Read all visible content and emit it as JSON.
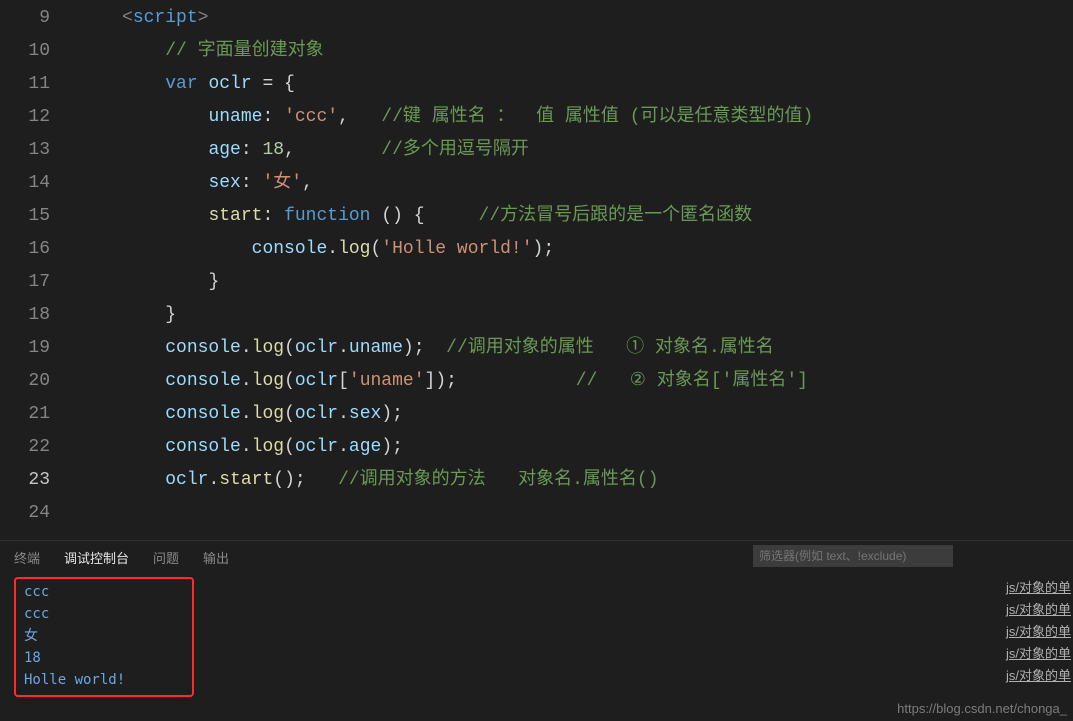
{
  "editor": {
    "lines": [
      {
        "num": 9,
        "segs": [
          " ",
          "<",
          "script",
          ">"
        ],
        "cls": [
          "sp",
          "tok-tag",
          "tok-tagname",
          "tok-tag"
        ]
      },
      {
        "num": 10,
        "segs": [
          "     ",
          "// 字面量创建对象"
        ],
        "cls": [
          "sp",
          "tok-comment"
        ]
      },
      {
        "num": 11,
        "segs": [
          "     ",
          "var ",
          "oclr",
          " = {"
        ],
        "cls": [
          "sp",
          "tok-keyword",
          "tok-var",
          "tok-punc"
        ]
      },
      {
        "num": 12,
        "segs": [
          "         ",
          "uname",
          ": ",
          "'ccc'",
          ",   ",
          "//键 属性名 ：  值 属性值 (可以是任意类型的值)"
        ],
        "cls": [
          "sp",
          "tok-prop",
          "tok-punc",
          "tok-string",
          "tok-punc",
          "tok-comment"
        ]
      },
      {
        "num": 13,
        "segs": [
          "         ",
          "age",
          ": ",
          "18",
          ",        ",
          "//多个用逗号隔开"
        ],
        "cls": [
          "sp",
          "tok-prop",
          "tok-punc",
          "tok-num",
          "tok-punc",
          "tok-comment"
        ]
      },
      {
        "num": 14,
        "segs": [
          "         ",
          "sex",
          ": ",
          "'女'",
          ","
        ],
        "cls": [
          "sp",
          "tok-prop",
          "tok-punc",
          "tok-string",
          "tok-punc"
        ]
      },
      {
        "num": 15,
        "segs": [
          "         ",
          "start",
          ": ",
          "function",
          " () {     ",
          "//方法冒号后跟的是一个匿名函数"
        ],
        "cls": [
          "sp",
          "tok-func",
          "tok-punc",
          "tok-keyword",
          "tok-punc",
          "tok-comment"
        ]
      },
      {
        "num": 16,
        "segs": [
          "             ",
          "console",
          ".",
          "log",
          "(",
          "'Holle world!'",
          ");"
        ],
        "cls": [
          "sp",
          "tok-var",
          "tok-punc",
          "tok-func",
          "tok-punc",
          "tok-string",
          "tok-punc"
        ]
      },
      {
        "num": 17,
        "segs": [
          "         ",
          "}"
        ],
        "cls": [
          "sp",
          "tok-punc"
        ]
      },
      {
        "num": 18,
        "segs": [
          "     ",
          "}"
        ],
        "cls": [
          "sp",
          "tok-punc"
        ]
      },
      {
        "num": 19,
        "segs": [
          "     ",
          "console",
          ".",
          "log",
          "(",
          "oclr",
          ".",
          "uname",
          ");  ",
          "//调用对象的属性   ① 对象名.属性名"
        ],
        "cls": [
          "sp",
          "tok-var",
          "tok-punc",
          "tok-func",
          "tok-punc",
          "tok-var",
          "tok-punc",
          "tok-prop",
          "tok-punc",
          "tok-comment"
        ]
      },
      {
        "num": 20,
        "segs": [
          "     ",
          "console",
          ".",
          "log",
          "(",
          "oclr",
          "[",
          "'uname'",
          "]);           ",
          "//   ② 对象名['属性名']"
        ],
        "cls": [
          "sp",
          "tok-var",
          "tok-punc",
          "tok-func",
          "tok-punc",
          "tok-var",
          "tok-punc",
          "tok-string",
          "tok-punc",
          "tok-comment"
        ]
      },
      {
        "num": 21,
        "segs": [
          "     ",
          "console",
          ".",
          "log",
          "(",
          "oclr",
          ".",
          "sex",
          ");"
        ],
        "cls": [
          "sp",
          "tok-var",
          "tok-punc",
          "tok-func",
          "tok-punc",
          "tok-var",
          "tok-punc",
          "tok-prop",
          "tok-punc"
        ]
      },
      {
        "num": 22,
        "segs": [
          "     ",
          "console",
          ".",
          "log",
          "(",
          "oclr",
          ".",
          "age",
          ");"
        ],
        "cls": [
          "sp",
          "tok-var",
          "tok-punc",
          "tok-func",
          "tok-punc",
          "tok-var",
          "tok-punc",
          "tok-prop",
          "tok-punc"
        ]
      },
      {
        "num": 23,
        "segs": [
          "     ",
          "oclr",
          ".",
          "start",
          "();   ",
          "//调用对象的方法   对象名.属性名()"
        ],
        "cls": [
          "sp",
          "tok-var",
          "tok-punc",
          "tok-func",
          "tok-punc",
          "tok-comment"
        ],
        "current": true
      },
      {
        "num": 24,
        "segs": [
          ""
        ],
        "cls": [
          "sp"
        ]
      }
    ]
  },
  "panel": {
    "tabs": {
      "terminal": "终端",
      "debug_console": "调试控制台",
      "problems": "问题",
      "output": "输出"
    },
    "filter_placeholder": "筛选器(例如 text、!exclude)",
    "console": [
      "ccc",
      "ccc",
      "女",
      "18",
      "Holle world!"
    ],
    "source": "js/对象的单",
    "watermark": "https://blog.csdn.net/chonga_"
  }
}
